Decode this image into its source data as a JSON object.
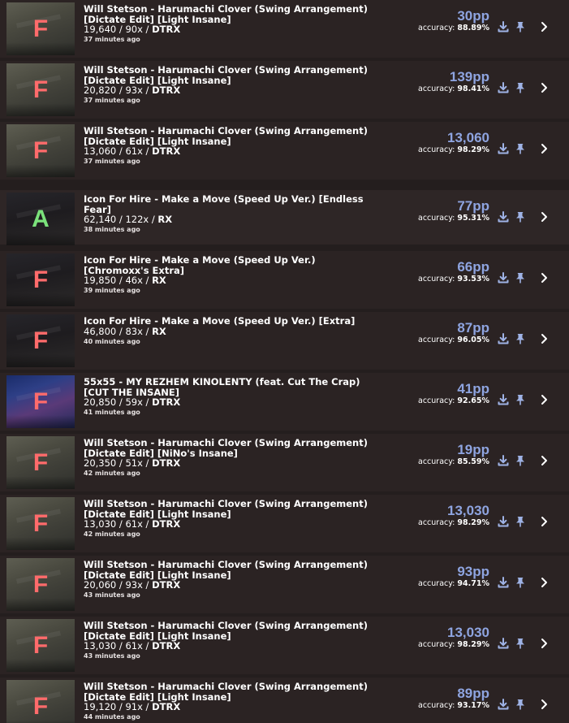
{
  "rows": [
    {
      "grade": "F",
      "title": "Will Stetson - Harumachi Clover (Swing Arrangement) [Dictate Edit] [Light Insane]",
      "score": "19,640",
      "combo": "90x",
      "mods": "DTRX",
      "time": "37 minutes ago",
      "pp": "30pp",
      "acc_label": "accuracy:",
      "acc": "88.89%",
      "thumb": "green"
    },
    {
      "grade": "F",
      "title": "Will Stetson - Harumachi Clover (Swing Arrangement) [Dictate Edit] [Light Insane]",
      "score": "20,820",
      "combo": "93x",
      "mods": "DTRX",
      "time": "37 minutes ago",
      "pp": "139pp",
      "acc_label": "accuracy:",
      "acc": "98.41%",
      "thumb": "green"
    },
    {
      "grade": "F",
      "title": "Will Stetson - Harumachi Clover (Swing Arrangement) [Dictate Edit] [Light Insane]",
      "score": "13,060",
      "combo": "61x",
      "mods": "DTRX",
      "time": "37 minutes ago",
      "pp": "13,060",
      "acc_label": "accuracy:",
      "acc": "98.29%",
      "thumb": "green"
    },
    {
      "grade": "A",
      "title": "Icon For Hire - Make a Move (Speed Up Ver.) [Endless Fear]",
      "score": "62,140",
      "combo": "122x",
      "mods": "RX",
      "time": "38 minutes ago",
      "pp": "77pp",
      "acc_label": "accuracy:",
      "acc": "95.31%",
      "thumb": "dark"
    },
    {
      "grade": "F",
      "title": "Icon For Hire - Make a Move (Speed Up Ver.) [Chromoxx's Extra]",
      "score": "19,850",
      "combo": "46x",
      "mods": "RX",
      "time": "39 minutes ago",
      "pp": "66pp",
      "acc_label": "accuracy:",
      "acc": "93.53%",
      "thumb": "dark"
    },
    {
      "grade": "F",
      "title": "Icon For Hire - Make a Move (Speed Up Ver.) [Extra]",
      "score": "46,800",
      "combo": "83x",
      "mods": "RX",
      "time": "40 minutes ago",
      "pp": "87pp",
      "acc_label": "accuracy:",
      "acc": "96.05%",
      "thumb": "dark"
    },
    {
      "grade": "F",
      "title": "55x55 - MY REZHEM KINOLENTY (feat. Cut The Crap) [CUT THE INSANE]",
      "score": "20,850",
      "combo": "59x",
      "mods": "DTRX",
      "time": "41 minutes ago",
      "pp": "41pp",
      "acc_label": "accuracy:",
      "acc": "92.65%",
      "thumb": "blue"
    },
    {
      "grade": "F",
      "title": "Will Stetson - Harumachi Clover (Swing Arrangement) [Dictate Edit] [NiNo's Insane]",
      "score": "20,350",
      "combo": "51x",
      "mods": "DTRX",
      "time": "42 minutes ago",
      "pp": "19pp",
      "acc_label": "accuracy:",
      "acc": "85.59%",
      "thumb": "green"
    },
    {
      "grade": "F",
      "title": "Will Stetson - Harumachi Clover (Swing Arrangement) [Dictate Edit] [Light Insane]",
      "score": "13,030",
      "combo": "61x",
      "mods": "DTRX",
      "time": "42 minutes ago",
      "pp": "13,030",
      "acc_label": "accuracy:",
      "acc": "98.29%",
      "thumb": "green"
    },
    {
      "grade": "F",
      "title": "Will Stetson - Harumachi Clover (Swing Arrangement) [Dictate Edit] [Light Insane]",
      "score": "20,060",
      "combo": "93x",
      "mods": "DTRX",
      "time": "43 minutes ago",
      "pp": "93pp",
      "acc_label": "accuracy:",
      "acc": "94.71%",
      "thumb": "green"
    },
    {
      "grade": "F",
      "title": "Will Stetson - Harumachi Clover (Swing Arrangement) [Dictate Edit] [Light Insane]",
      "score": "13,030",
      "combo": "61x",
      "mods": "DTRX",
      "time": "43 minutes ago",
      "pp": "13,030",
      "acc_label": "accuracy:",
      "acc": "98.29%",
      "thumb": "green"
    },
    {
      "grade": "F",
      "title": "Will Stetson - Harumachi Clover (Swing Arrangement) [Dictate Edit] [Light Insane]",
      "score": "19,120",
      "combo": "91x",
      "mods": "DTRX",
      "time": "44 minutes ago",
      "pp": "89pp",
      "acc_label": "accuracy:",
      "acc": "93.17%",
      "thumb": "green"
    }
  ],
  "icons": {
    "download": "download-icon",
    "pin": "pin-icon",
    "expand": "chevron-right-icon"
  },
  "colors": {
    "pp": "#8ea4e0",
    "grade_f": "#ff6b6b",
    "grade_a": "#7be27b",
    "background": "#241e1e"
  }
}
